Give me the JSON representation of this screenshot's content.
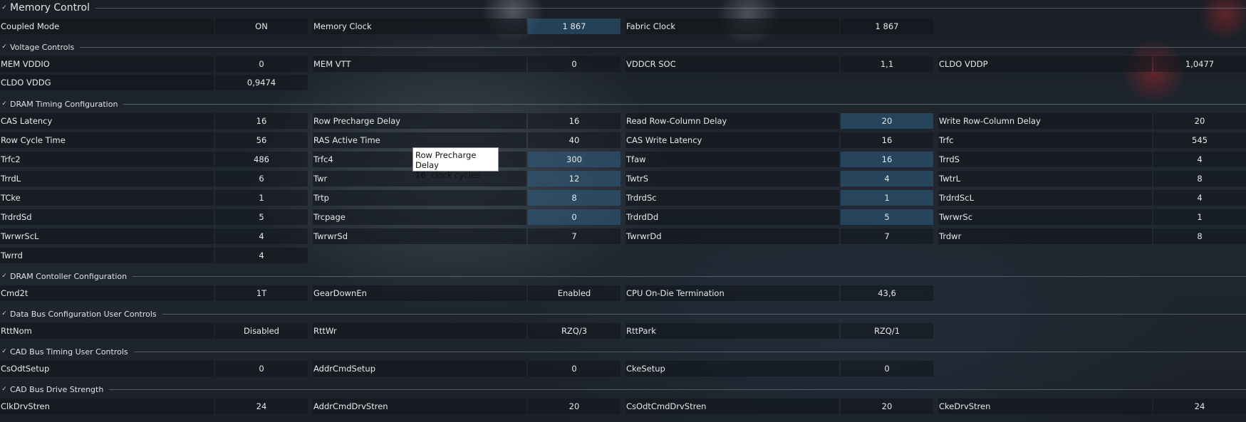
{
  "memory_control": {
    "title": "Memory Control",
    "rows": [
      [
        {
          "label": "Coupled Mode",
          "value": "ON"
        },
        {
          "label": "Memory Clock",
          "value": "1 867"
        },
        {
          "label": "Fabric Clock",
          "value": "1 867"
        }
      ]
    ]
  },
  "voltage_controls": {
    "title": "Voltage Controls",
    "rows": [
      [
        {
          "label": "MEM VDDIO",
          "value": "0"
        },
        {
          "label": "MEM VTT",
          "value": "0"
        },
        {
          "label": "VDDCR SOC",
          "value": "1,1"
        },
        {
          "label": "CLDO VDDP",
          "value": "1,0477"
        }
      ],
      [
        {
          "label": "CLDO VDDG",
          "value": "0,9474"
        }
      ]
    ]
  },
  "dram_timing": {
    "title": "DRAM Timing Configuration",
    "rows": [
      [
        {
          "label": "CAS Latency",
          "value": "16"
        },
        {
          "label": "Row Precharge Delay",
          "value": "16"
        },
        {
          "label": "Read Row-Column Delay",
          "value": "20"
        },
        {
          "label": "Write Row-Column Delay",
          "value": "20"
        }
      ],
      [
        {
          "label": "Row Cycle Time",
          "value": "56"
        },
        {
          "label": "RAS Active Time",
          "value": "40"
        },
        {
          "label": "CAS Write Latency",
          "value": "16"
        },
        {
          "label": "Trfc",
          "value": "545"
        }
      ],
      [
        {
          "label": "Trfc2",
          "value": "486"
        },
        {
          "label": "Trfc4",
          "value": "300"
        },
        {
          "label": "Tfaw",
          "value": "16"
        },
        {
          "label": "TrrdS",
          "value": "4"
        }
      ],
      [
        {
          "label": "TrrdL",
          "value": "6"
        },
        {
          "label": "Twr",
          "value": "12"
        },
        {
          "label": "TwtrS",
          "value": "4"
        },
        {
          "label": "TwtrL",
          "value": "8"
        }
      ],
      [
        {
          "label": "TCke",
          "value": "1"
        },
        {
          "label": "Trtp",
          "value": "8"
        },
        {
          "label": "TrdrdSc",
          "value": "1"
        },
        {
          "label": "TrdrdScL",
          "value": "4"
        }
      ],
      [
        {
          "label": "TrdrdSd",
          "value": "5"
        },
        {
          "label": "Trcpage",
          "value": "0"
        },
        {
          "label": "TrdrdDd",
          "value": "5"
        },
        {
          "label": "TwrwrSc",
          "value": "1"
        }
      ],
      [
        {
          "label": "TwrwrScL",
          "value": "4"
        },
        {
          "label": "TwrwrSd",
          "value": "7"
        },
        {
          "label": "TwrwrDd",
          "value": "7"
        },
        {
          "label": "Trdwr",
          "value": "8"
        }
      ],
      [
        {
          "label": "Twrrd",
          "value": "4"
        }
      ]
    ]
  },
  "dram_controller": {
    "title": "DRAM Contoller Configuration",
    "rows": [
      [
        {
          "label": "Cmd2t",
          "value": "1T"
        },
        {
          "label": "GearDownEn",
          "value": "Enabled"
        },
        {
          "label": "CPU On-Die Termination",
          "value": "43,6"
        }
      ]
    ]
  },
  "data_bus": {
    "title": "Data Bus Configuration User Controls",
    "rows": [
      [
        {
          "label": "RttNom",
          "value": "Disabled"
        },
        {
          "label": "RttWr",
          "value": "RZQ/3"
        },
        {
          "label": "RttPark",
          "value": "RZQ/1"
        }
      ]
    ]
  },
  "cad_timing": {
    "title": "CAD Bus Timing User Controls",
    "rows": [
      [
        {
          "label": "CsOdtSetup",
          "value": "0"
        },
        {
          "label": "AddrCmdSetup",
          "value": "0"
        },
        {
          "label": "CkeSetup",
          "value": "0"
        }
      ]
    ]
  },
  "cad_drive": {
    "title": "CAD Bus Drive Strength",
    "rows": [
      [
        {
          "label": "ClkDrvStren",
          "value": "24"
        },
        {
          "label": "AddrCmdDrvStren",
          "value": "20"
        },
        {
          "label": "CsOdtCmdDrvStren",
          "value": "20"
        },
        {
          "label": "CkeDrvStren",
          "value": "24"
        }
      ]
    ]
  },
  "tooltip": {
    "title": "Row Precharge Delay",
    "detail": "16  clock cycles"
  },
  "colors": {
    "highlight_value_bg": "#2c5c80",
    "tooltip_bg": "#ffffff"
  }
}
